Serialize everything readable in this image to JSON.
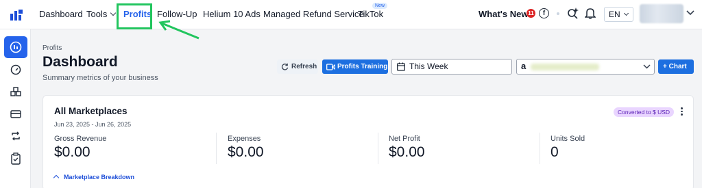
{
  "topnav": {
    "items": [
      {
        "label": "Dashboard"
      },
      {
        "label": "Tools"
      },
      {
        "label": "Profits"
      },
      {
        "label": "Follow-Up"
      },
      {
        "label": "Helium 10 Ads"
      },
      {
        "label": "Managed Refund Service"
      },
      {
        "label": "TikTok"
      }
    ],
    "new_badge": "New",
    "whats_new": "What's New?",
    "whats_new_count": "11",
    "language": "EN",
    "highlight_color": "#22c55e"
  },
  "sidebar": {
    "icons": [
      "dashboard-icon",
      "gauge-icon",
      "boxes-icon",
      "credit-card-icon",
      "refresh-arrows-icon",
      "clipboard-check-icon"
    ]
  },
  "header": {
    "breadcrumb": "Profits",
    "title": "Dashboard",
    "subtitle": "Summary metrics of your business"
  },
  "toolbar": {
    "refresh_label": "Refresh",
    "training_label": "Profits Training",
    "date_range": "This Week",
    "marketplace_prefix": "a",
    "chart_label": "+ Chart"
  },
  "card": {
    "title": "All Marketplaces",
    "date_range": "Jun 23, 2025 - Jun 26, 2025",
    "badge": "Converted to $ USD",
    "metrics": [
      {
        "label": "Gross Revenue",
        "value": "$0.00"
      },
      {
        "label": "Expenses",
        "value": "$0.00"
      },
      {
        "label": "Net Profit",
        "value": "$0.00"
      },
      {
        "label": "Units Sold",
        "value": "0"
      }
    ],
    "breakdown_label": "Marketplace Breakdown"
  },
  "colors": {
    "primary": "#1d6fe0",
    "active_nav": "#2563eb",
    "badge_purple": "#e9d5ff"
  }
}
